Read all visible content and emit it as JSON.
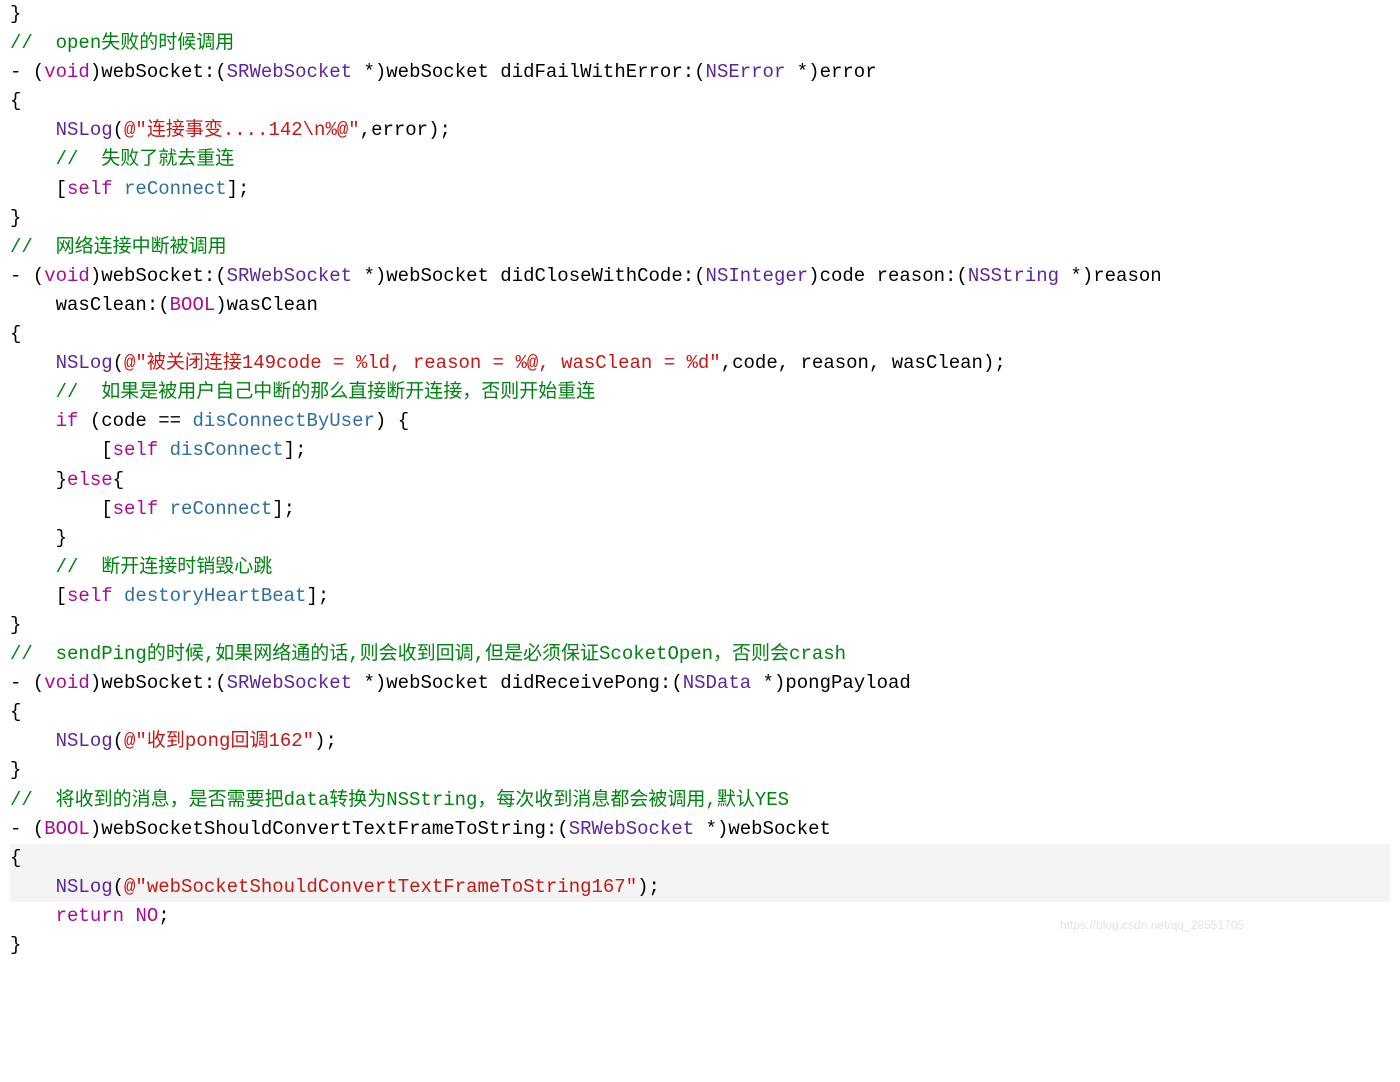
{
  "code": {
    "l01": "}",
    "c02": "//  open失败的时候调用",
    "l03a": "- (",
    "l03_kw_void": "void",
    "l03b": ")webSocket:(",
    "l03_ty1": "SRWebSocket",
    "l03c": " *)webSocket didFailWithError:(",
    "l03_ty2": "NSError",
    "l03d": " *)error",
    "l04": "{",
    "l05_nslog": "NSLog",
    "l05a": "(",
    "l05_str": "@\"连接事变....142\\n%@\"",
    "l05b": ",error);",
    "c06": "//  失败了就去重连",
    "l07a": "[",
    "l07_self": "self",
    "l07_sp": " ",
    "l07_msg": "reConnect",
    "l07b": "];",
    "l08": "}",
    "c09": "//  网络连接中断被调用",
    "l10a": "- (",
    "l10_kw_void": "void",
    "l10b": ")webSocket:(",
    "l10_ty1": "SRWebSocket",
    "l10c": " *)webSocket didCloseWithCode:(",
    "l10_ty2": "NSInteger",
    "l10d": ")code reason:(",
    "l10_ty3": "NSString",
    "l10e": " *)reason",
    "l11a": "wasClean:(",
    "l11_ty": "BOOL",
    "l11b": ")wasClean",
    "l12": "{",
    "l13_nslog": "NSLog",
    "l13a": "(",
    "l13_str": "@\"被关闭连接149code = %ld, reason = %@, wasClean = %d\"",
    "l13b": ",code, reason, wasClean);",
    "c14": "//  如果是被用户自己中断的那么直接断开连接，否则开始重连",
    "l15_if": "if",
    "l15a": " (code == ",
    "l15_enum": "disConnectByUser",
    "l15b": ") {",
    "l16a": "[",
    "l16_self": "self",
    "l16_sp": " ",
    "l16_msg": "disConnect",
    "l16b": "];",
    "l17a": "}",
    "l17_else": "else",
    "l17b": "{",
    "l18a": "[",
    "l18_self": "self",
    "l18_sp": " ",
    "l18_msg": "reConnect",
    "l18b": "];",
    "l19": "}",
    "c20": "//  断开连接时销毁心跳",
    "l21a": "[",
    "l21_self": "self",
    "l21_sp": " ",
    "l21_msg": "destoryHeartBeat",
    "l21b": "];",
    "l22": "}",
    "c23": "//  sendPing的时候,如果网络通的话,则会收到回调,但是必须保证ScoketOpen，否则会crash",
    "l24a": "- (",
    "l24_kw_void": "void",
    "l24b": ")webSocket:(",
    "l24_ty1": "SRWebSocket",
    "l24c": " *)webSocket didReceivePong:(",
    "l24_ty2": "NSData",
    "l24d": " *)pongPayload",
    "l25": "{",
    "l26_nslog": "NSLog",
    "l26a": "(",
    "l26_str": "@\"收到pong回调162\"",
    "l26b": ");",
    "l27": "}",
    "c28": "//  将收到的消息，是否需要把data转换为NSString，每次收到消息都会被调用,默认YES",
    "l29a": "- (",
    "l29_ty_bool": "BOOL",
    "l29b": ")webSocketShouldConvertTextFrameToString:(",
    "l29_ty1": "SRWebSocket",
    "l29c": " *)webSocket",
    "l30": "{",
    "l31_nslog": "NSLog",
    "l31a": "(",
    "l31_str": "@\"webSocketShouldConvertTextFrameToString167\"",
    "l31b": ");",
    "l32_ret": "return",
    "l32_sp": " ",
    "l32_no": "NO",
    "l32b": ";",
    "l33": "}"
  },
  "watermark": "https://blog.csdn.net/qq_28551705"
}
